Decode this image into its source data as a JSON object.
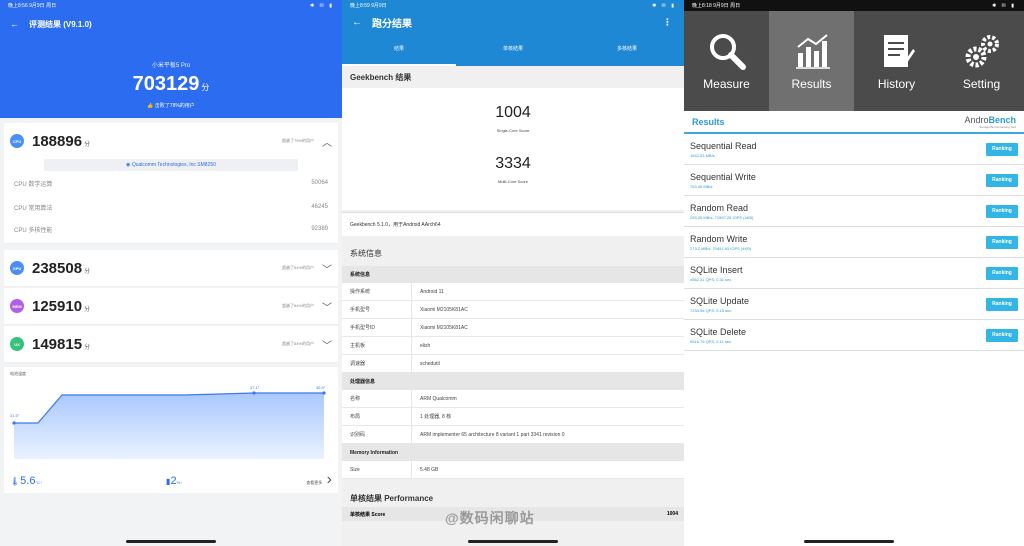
{
  "antutu": {
    "status_time": "晚上8:56 9月9日 周日",
    "status_icons": "✱ ✉ ▮",
    "nav_title": "评测结果 (V9.1.0)",
    "device": "小米平板5 Pro",
    "total": "703129",
    "unit": "分",
    "beat": "击败了78%的用户",
    "cpu": {
      "badge": "CPU",
      "score": "188896",
      "unit": "分",
      "rank": "超越了79%的用户"
    },
    "chip": "Qualcomm Technologies, Inc SM8250",
    "cpu_sub": [
      {
        "label": "CPU 数学运算",
        "value": "50064"
      },
      {
        "label": "CPU 常用算法",
        "value": "46245"
      },
      {
        "label": "CPU 多核性能",
        "value": "92389"
      }
    ],
    "gpu": {
      "badge": "GPU",
      "score": "238508",
      "unit": "分",
      "rank": "超越了84%的用户"
    },
    "mem": {
      "badge": "MEM",
      "score": "125910",
      "unit": "分",
      "rank": "超越了84%的用户"
    },
    "ux": {
      "badge": "UX",
      "score": "149815",
      "unit": "分",
      "rank": "超越了84%的用户"
    },
    "chart_title": "电池温度",
    "chart_labels": {
      "start": "31.5°",
      "mid": "37.1°",
      "end": "36.9°"
    },
    "temp_rise": "5.6",
    "temp_unit": "°C↑",
    "batt_drop": "2",
    "batt_unit": "%↓",
    "more": "查看更多"
  },
  "geekbench": {
    "status_time": "晚上8:59 9月9日",
    "status_icons": "✱ ✉ ▮",
    "title": "跑分结果",
    "tabs": [
      "结果",
      "单核结果",
      "多核结果"
    ],
    "section": "Geekbench 结果",
    "single": "1004",
    "single_label": "Single-Core Score",
    "multi": "3334",
    "multi_label": "Multi-Core Score",
    "version": "Geekbench 5.1.0，用于Android AArch64",
    "sys_title": "系统信息",
    "sys_header": "系统信息",
    "sys_rows": [
      {
        "k": "操作系统",
        "v": "Android 11"
      },
      {
        "k": "手机型号",
        "v": "Xiaomi M2105K81AC"
      },
      {
        "k": "手机型号ID",
        "v": "Xiaomi M2105K81AC"
      },
      {
        "k": "主机板",
        "v": "elish"
      },
      {
        "k": "调速器",
        "v": "schedutil"
      }
    ],
    "cpu_header": "处理器信息",
    "cpu_rows": [
      {
        "k": "名称",
        "v": "ARM Qualcomm"
      },
      {
        "k": "布局",
        "v": "1 处理器, 8 核"
      },
      {
        "k": "识别码",
        "v": "ARM implementer 65 architecture 8 variant 1 part 3341 revision 0"
      }
    ],
    "mem_header": "Memory Information",
    "mem_rows": [
      {
        "k": "Size",
        "v": "5.48 GB"
      }
    ],
    "perf_title": "单核结果 Performance",
    "perf_row_label": "单核结果 Score",
    "perf_row_value": "1004",
    "watermark": "@数码闲聊站"
  },
  "androbench": {
    "status_time": "晚上8:18 9月9日 周日",
    "status_icons": "✱ ✉ ▮",
    "tabs": [
      {
        "label": "Measure",
        "icon": "magnifier-icon"
      },
      {
        "label": "Results",
        "icon": "bar-chart-icon"
      },
      {
        "label": "History",
        "icon": "document-icon"
      },
      {
        "label": "Setting",
        "icon": "gears-icon"
      }
    ],
    "results_label": "Results",
    "logo_a": "Andro",
    "logo_b": "Bench",
    "logo_sub": "Storage Benchmarking Tool",
    "ranking_label": "Ranking",
    "items": [
      {
        "name": "Sequential Read",
        "value": "1642.53 MB/s"
      },
      {
        "name": "Sequential Write",
        "value": "763.45 MB/s"
      },
      {
        "name": "Random Read",
        "value": "293.26 MB/s, 71597.25 IOPS (4KB)"
      },
      {
        "name": "Random Write",
        "value": "273.2 MB/s, 70451.93 IOPS (4KB)"
      },
      {
        "name": "SQLite Insert",
        "value": "4562.31 QPS, 0.31 sec"
      },
      {
        "name": "SQLite Update",
        "value": "7234.56 QPS, 0.15 sec"
      },
      {
        "name": "SQLite Delete",
        "value": "9516.79 QPS, 0.11 sec"
      }
    ]
  }
}
